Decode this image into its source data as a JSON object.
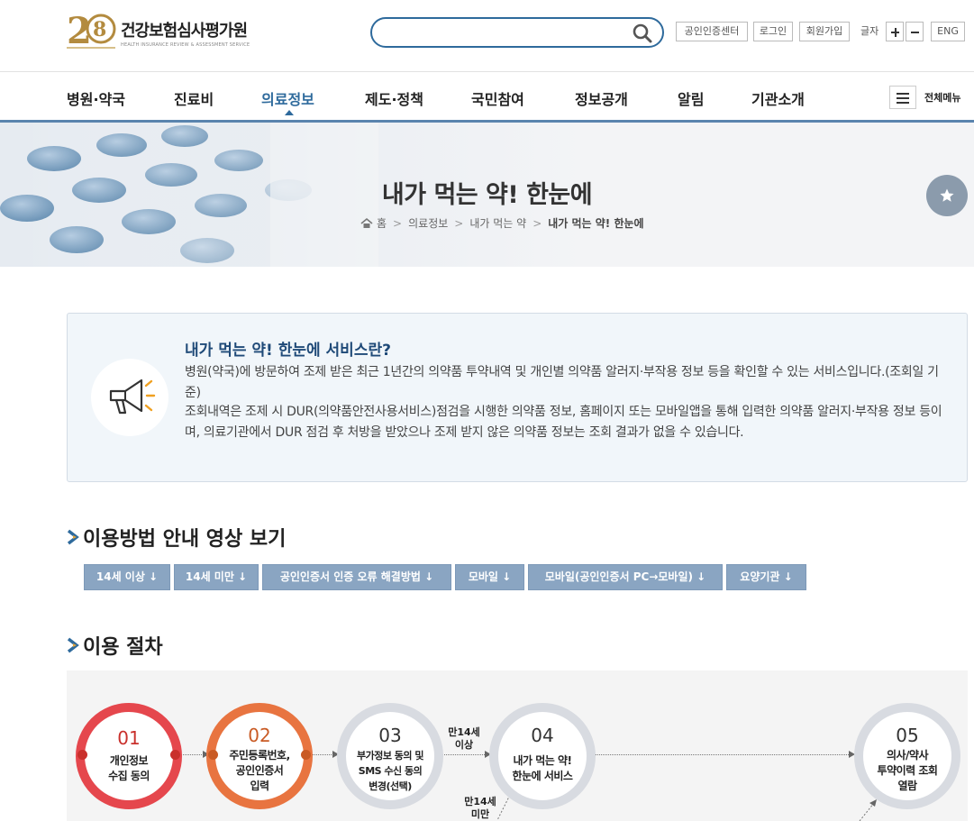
{
  "logo": {
    "mark_text": "28",
    "name": "건강보험심사평가원",
    "sub": "HEALTH INSURANCE REVIEW & ASSESSMENT SERVICE",
    "mark_sub": "건강보험심사평가원 20주년"
  },
  "search": {
    "placeholder": "",
    "value": ""
  },
  "util": {
    "cert_center": "공인인증센터",
    "login": "로그인",
    "join": "회원가입",
    "font_label": "글자",
    "eng": "ENG"
  },
  "gnb": {
    "items": [
      {
        "label": "병원·약국"
      },
      {
        "label": "진료비"
      },
      {
        "label": "의료정보"
      },
      {
        "label": "제도·정책"
      },
      {
        "label": "국민참여"
      },
      {
        "label": "정보공개"
      },
      {
        "label": "알림"
      },
      {
        "label": "기관소개"
      }
    ],
    "active_index": 2,
    "all_menu": "전체메뉴"
  },
  "visual": {
    "title": "내가 먹는 약! 한눈에",
    "breadcrumb": [
      "홈",
      "의료정보",
      "내가 먹는 약",
      "내가 먹는 약! 한눈에"
    ]
  },
  "intro": {
    "heading": "내가 먹는 약! 한눈에 서비스란?",
    "p1": "병원(약국)에 방문하여 조제 받은 최근 1년간의 의약품 투약내역 및 개인별 의약품 알러지·부작용 정보 등을 확인할 수 있는 서비스입니다.(조회일 기준)",
    "p2": "조회내역은 조제 시 DUR(의약품안전사용서비스)점검을 시행한 의약품 정보, 홈페이지 또는 모바일앱을 통해 입력한 의약품 알러지·부작용 정보 등이며, 의료기관에서 DUR 점검 후 처방을 받았으나 조제 받지 않은 의약품 정보는 조회 결과가 없을 수 있습니다."
  },
  "video": {
    "title": "이용방법 안내 영상 보기",
    "tabs": [
      {
        "label": "14세 이상 ↓"
      },
      {
        "label": "14세 미만 ↓"
      },
      {
        "label": "공인인증서 인증 오류 해결방법 ↓"
      },
      {
        "label": "모바일 ↓"
      },
      {
        "label": "모바일(공인인증서 PC→모바일) ↓"
      },
      {
        "label": "요양기관 ↓"
      }
    ]
  },
  "procedure": {
    "title": "이용 절차",
    "steps": [
      {
        "num": "01",
        "lines": [
          "개인정보",
          "수집 동의"
        ],
        "color": "#e5474d"
      },
      {
        "num": "02",
        "lines": [
          "주민등록번호,",
          "공인인증서",
          "입력"
        ],
        "color": "#e87440"
      },
      {
        "num": "03",
        "lines": [
          "부가정보 동의 및",
          "SMS 수신 동의",
          "변경(선택)"
        ],
        "color": "#d8dbe1"
      },
      {
        "num": "04",
        "lines": [
          "내가 먹는 약!",
          "한눈에 서비스"
        ],
        "color": "#d8dbe1"
      },
      {
        "num": "05",
        "lines": [
          "의사/약사",
          "투약이력 조회",
          "열람"
        ],
        "color": "#d8dbe1"
      }
    ],
    "age_over": [
      "만14세",
      "이상"
    ],
    "age_under": [
      "만14세",
      "미만"
    ]
  },
  "colors": {
    "brand_blue": "#2e6a9c",
    "tab_blue": "#8aa5c2",
    "intro_bg": "#f1f6fa",
    "step1": "#e5474d",
    "step2": "#e87440",
    "step_gray": "#d8dbe1"
  }
}
